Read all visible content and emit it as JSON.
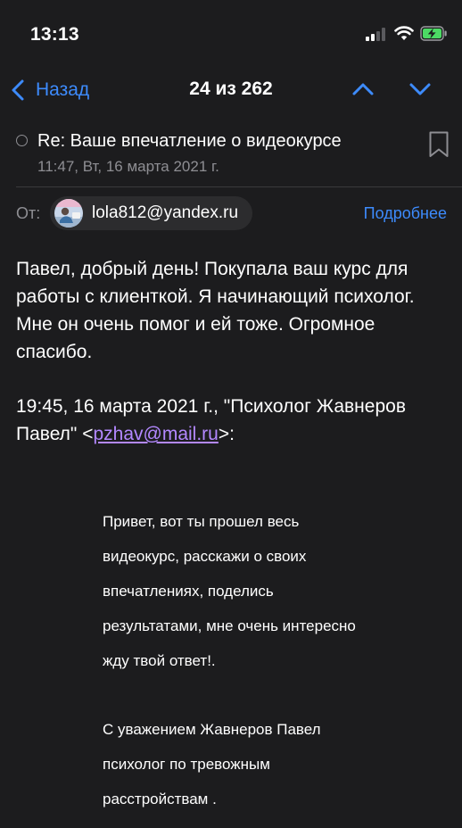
{
  "status_bar": {
    "time": "13:13"
  },
  "nav": {
    "back_label": "Назад",
    "counter": "24 из 262"
  },
  "email": {
    "subject": "Re: Ваше впечатление о видеокурсе",
    "date": "11:47, Вт, 16 марта 2021 г.",
    "from_label": "От:",
    "sender_email": "lola812@yandex.ru",
    "details_label": "Подробнее",
    "body_text": "Павел, добрый день! Покупала ваш курс для работы с клиенткой. Я начинающий психолог.  Мне он очень помог и ей тоже. Огромное спасибо.",
    "quote_header_prefix": "19:45, 16 марта 2021 г., \"Психолог Жавнеров Павел\" <",
    "quote_email": "pzhav@mail.ru",
    "quote_header_suffix": ">:",
    "quoted_lines": [
      "Привет, вот ты прошел весь",
      "видеокурс, расскажи о своих",
      "впечатлениях, поделись",
      "результатами, мне очень интересно",
      "жду твой ответ!."
    ],
    "signature_lines": [
      "С уважением Жавнеров Павел",
      "психолог по тревожным",
      "расстройствам ."
    ]
  },
  "colors": {
    "background": "#1c1c1e",
    "accent": "#3d8bfd",
    "link": "#b388ff",
    "secondary_text": "#8e8e93",
    "battery_charging": "#4cd964"
  },
  "icons": {
    "back": "chevron-left-icon",
    "previous": "chevron-up-icon",
    "next": "chevron-down-icon",
    "bookmark": "bookmark-icon",
    "signal": "cellular-signal-icon",
    "wifi": "wifi-icon",
    "battery": "battery-charging-icon"
  }
}
